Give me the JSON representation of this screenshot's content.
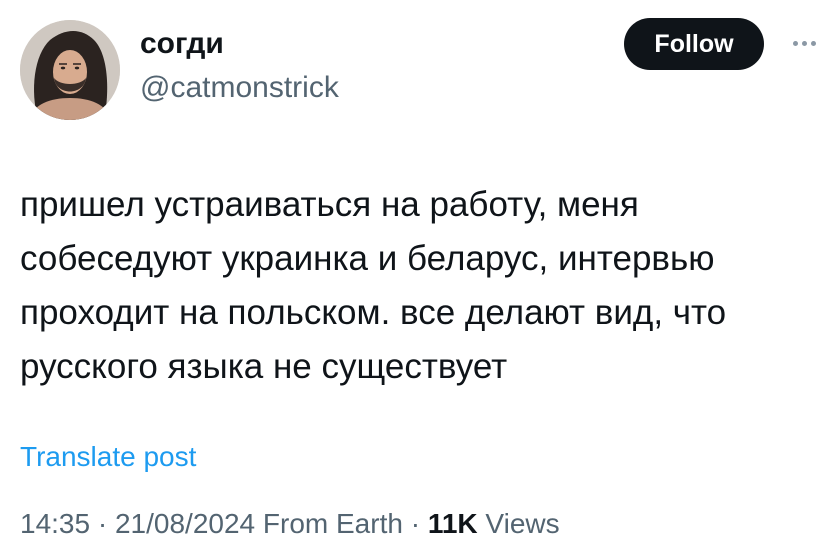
{
  "author": {
    "display_name": "согди",
    "handle": "@catmonstrick",
    "follow_label": "Follow"
  },
  "tweet": {
    "lines": [
      "пришел устраиваться на работу, меня",
      "собеседуют украинка и беларус, интервью",
      "проходит на польском. все делают вид, что",
      "русского языка не существует"
    ],
    "translate_label": "Translate post"
  },
  "meta": {
    "time": "14:35",
    "separator": " · ",
    "date": "21/08/2024",
    "source": "From Earth",
    "views_count": "11K",
    "views_label": "Views"
  },
  "icons": {
    "more": "more-horizontal-icon"
  },
  "colors": {
    "text": "#0f1419",
    "secondary": "#536471",
    "link": "#1d9bf0",
    "follow_bg": "#0f1419"
  }
}
